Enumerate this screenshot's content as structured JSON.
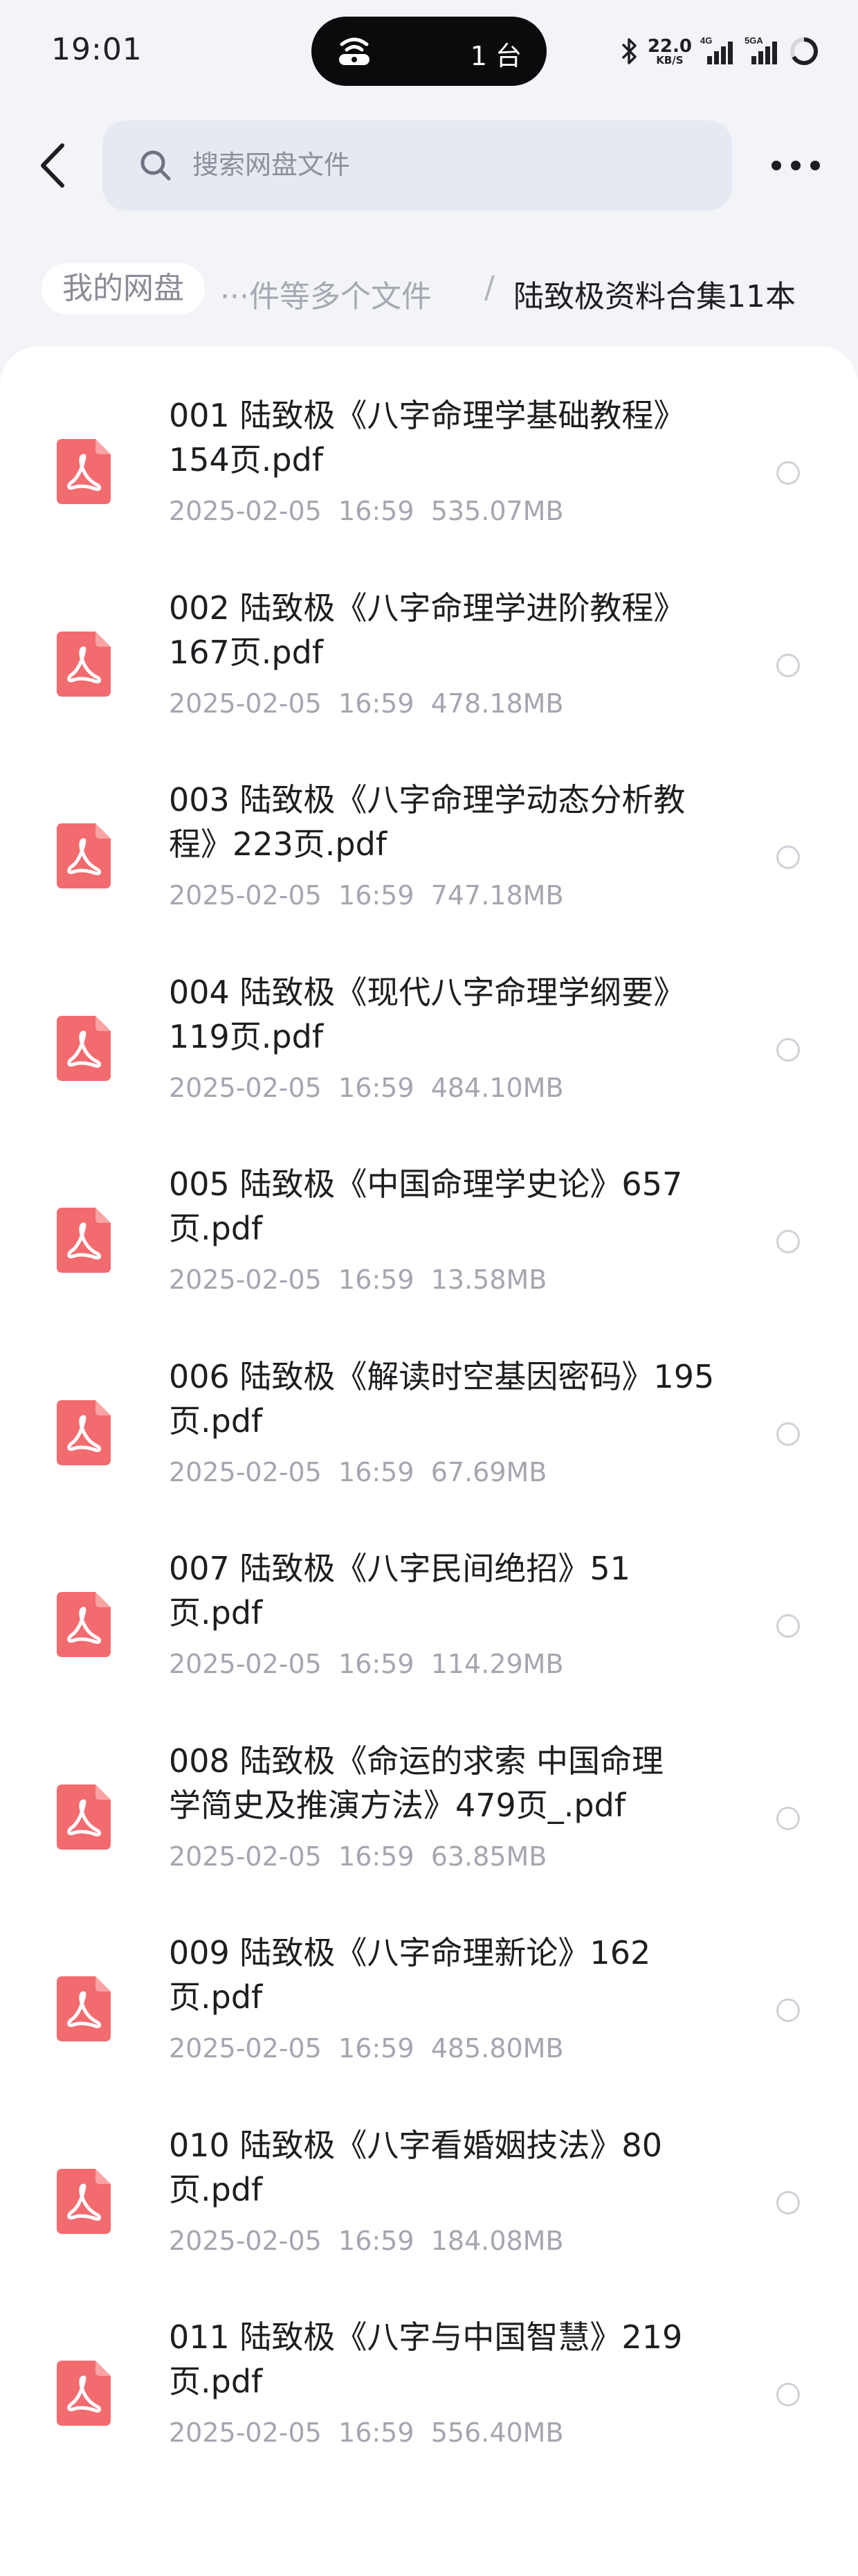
{
  "status_bar": {
    "time": "19:01",
    "island_text": "1 台",
    "speed_value": "22.0",
    "speed_unit": "KB/S",
    "signal_1_label": "4G",
    "signal_2_label": "5GA"
  },
  "header": {
    "search_placeholder": "搜索网盘文件"
  },
  "breadcrumb": {
    "home": "我的网盘",
    "middle": "···件等多个文件",
    "separator": "/",
    "current": "陆致极资料合集11本"
  },
  "files": [
    {
      "name_line1": "001 陆致极《八字命理学基础教程》",
      "name_line2": "154页.pdf",
      "date": "2025-02-05",
      "time": "16:59",
      "size": "535.07MB"
    },
    {
      "name_line1": "002 陆致极《八字命理学进阶教程》",
      "name_line2": "167页.pdf",
      "date": "2025-02-05",
      "time": "16:59",
      "size": "478.18MB"
    },
    {
      "name_line1": "003 陆致极《八字命理学动态分析教",
      "name_line2": "程》223页.pdf",
      "date": "2025-02-05",
      "time": "16:59",
      "size": "747.18MB"
    },
    {
      "name_line1": "004 陆致极《现代八字命理学纲要》",
      "name_line2": "119页.pdf",
      "date": "2025-02-05",
      "time": "16:59",
      "size": "484.10MB"
    },
    {
      "name_line1": "005 陆致极《中国命理学史论》657",
      "name_line2": "页.pdf",
      "date": "2025-02-05",
      "time": "16:59",
      "size": "13.58MB"
    },
    {
      "name_line1": "006 陆致极《解读时空基因密码》195",
      "name_line2": "页.pdf",
      "date": "2025-02-05",
      "time": "16:59",
      "size": "67.69MB"
    },
    {
      "name_line1": "007  陆致极《八字民间绝招》51",
      "name_line2": "页.pdf",
      "date": "2025-02-05",
      "time": "16:59",
      "size": "114.29MB"
    },
    {
      "name_line1": "008  陆致极《命运的求索  中国命理",
      "name_line2": "学简史及推演方法》479页_.pdf",
      "date": "2025-02-05",
      "time": "16:59",
      "size": "63.85MB"
    },
    {
      "name_line1": "009 陆致极《八字命理新论》162",
      "name_line2": "页.pdf",
      "date": "2025-02-05",
      "time": "16:59",
      "size": "485.80MB"
    },
    {
      "name_line1": "010 陆致极《八字看婚姻技法》80",
      "name_line2": "页.pdf",
      "date": "2025-02-05",
      "time": "16:59",
      "size": "184.08MB"
    },
    {
      "name_line1": "011 陆致极《八字与中国智慧》219",
      "name_line2": "页.pdf",
      "date": "2025-02-05",
      "time": "16:59",
      "size": "556.40MB"
    }
  ],
  "colors": {
    "page_bg": "#f3f4f8",
    "pdf_icon": "#f26b6f",
    "text_primary": "#1e1e22",
    "text_secondary": "#a4a6b0"
  }
}
